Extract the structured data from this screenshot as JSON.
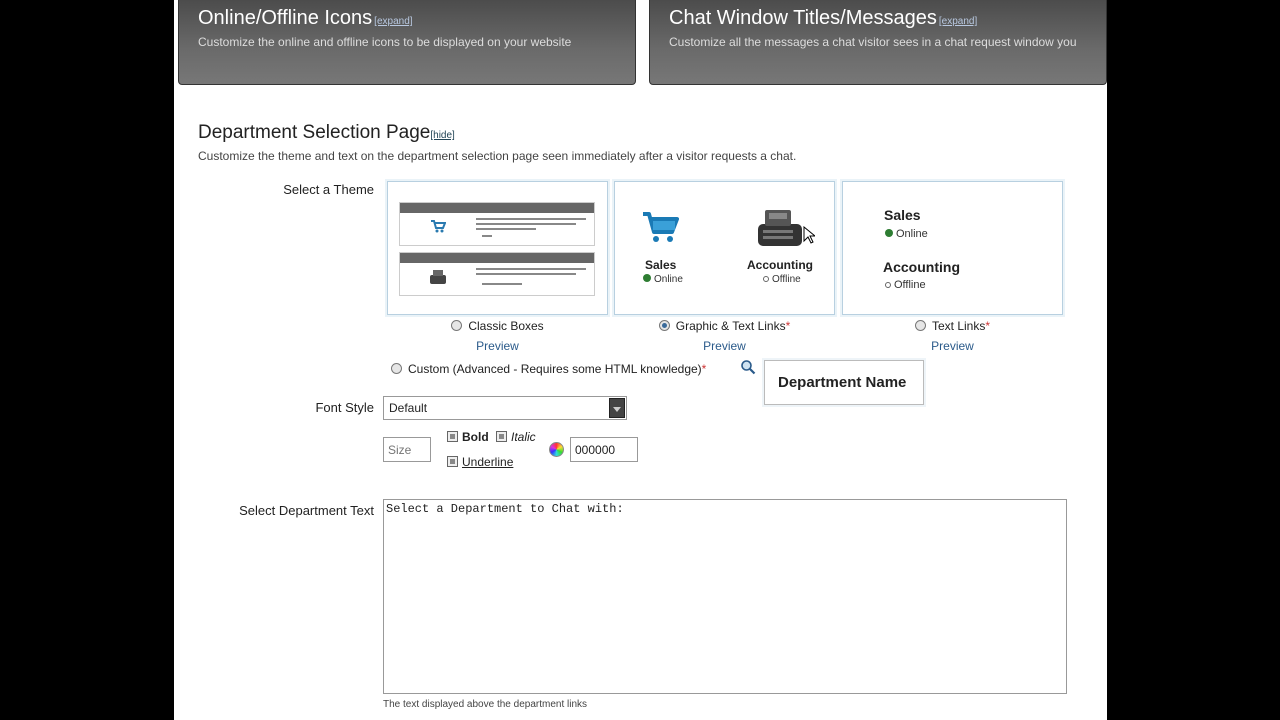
{
  "panels": [
    {
      "title": "Online/Offline Icons",
      "expand": "[expand]",
      "desc": "Customize the online and offline icons to be displayed on your website"
    },
    {
      "title": "Chat Window Titles/Messages",
      "expand": "[expand]",
      "desc": "Customize all the messages a chat visitor sees in a chat request window you"
    }
  ],
  "section": {
    "title": "Department Selection Page",
    "hide": "[hide]",
    "desc": "Customize the theme and text on the department selection page seen immediately after a visitor requests a chat."
  },
  "labels": {
    "select_theme": "Select a Theme",
    "font_style": "Font Style",
    "select_dept_text": "Select Department Text"
  },
  "themes": [
    {
      "label": "Classic Boxes",
      "preview": "Preview",
      "selected": false,
      "required": false
    },
    {
      "label": "Graphic & Text Links",
      "preview": "Preview",
      "selected": true,
      "required": true
    },
    {
      "label": "Text Links",
      "preview": "Preview",
      "selected": false,
      "required": true
    }
  ],
  "graphic_preview": {
    "sales": {
      "name": "Sales",
      "status": "Online"
    },
    "accounting": {
      "name": "Accounting",
      "status": "Offline"
    }
  },
  "text_preview": {
    "sales": {
      "name": "Sales",
      "status": "Online"
    },
    "accounting": {
      "name": "Accounting",
      "status": "Offline"
    }
  },
  "custom_option": {
    "label": "Custom (Advanced - Requires some HTML knowledge)",
    "required_mark": "*"
  },
  "required_mark": "*",
  "dept_name_preview": "Department Name",
  "font": {
    "selected": "Default",
    "size_placeholder": "Size",
    "bold": "Bold",
    "italic": "Italic",
    "underline": "Underline",
    "color": "000000"
  },
  "dept_text": {
    "value": "Select a Department to Chat with:",
    "hint": "The text displayed above the department links"
  },
  "colors": {
    "online": "#2e7d32",
    "link": "#2a5a8a",
    "required": "#cc3333"
  }
}
